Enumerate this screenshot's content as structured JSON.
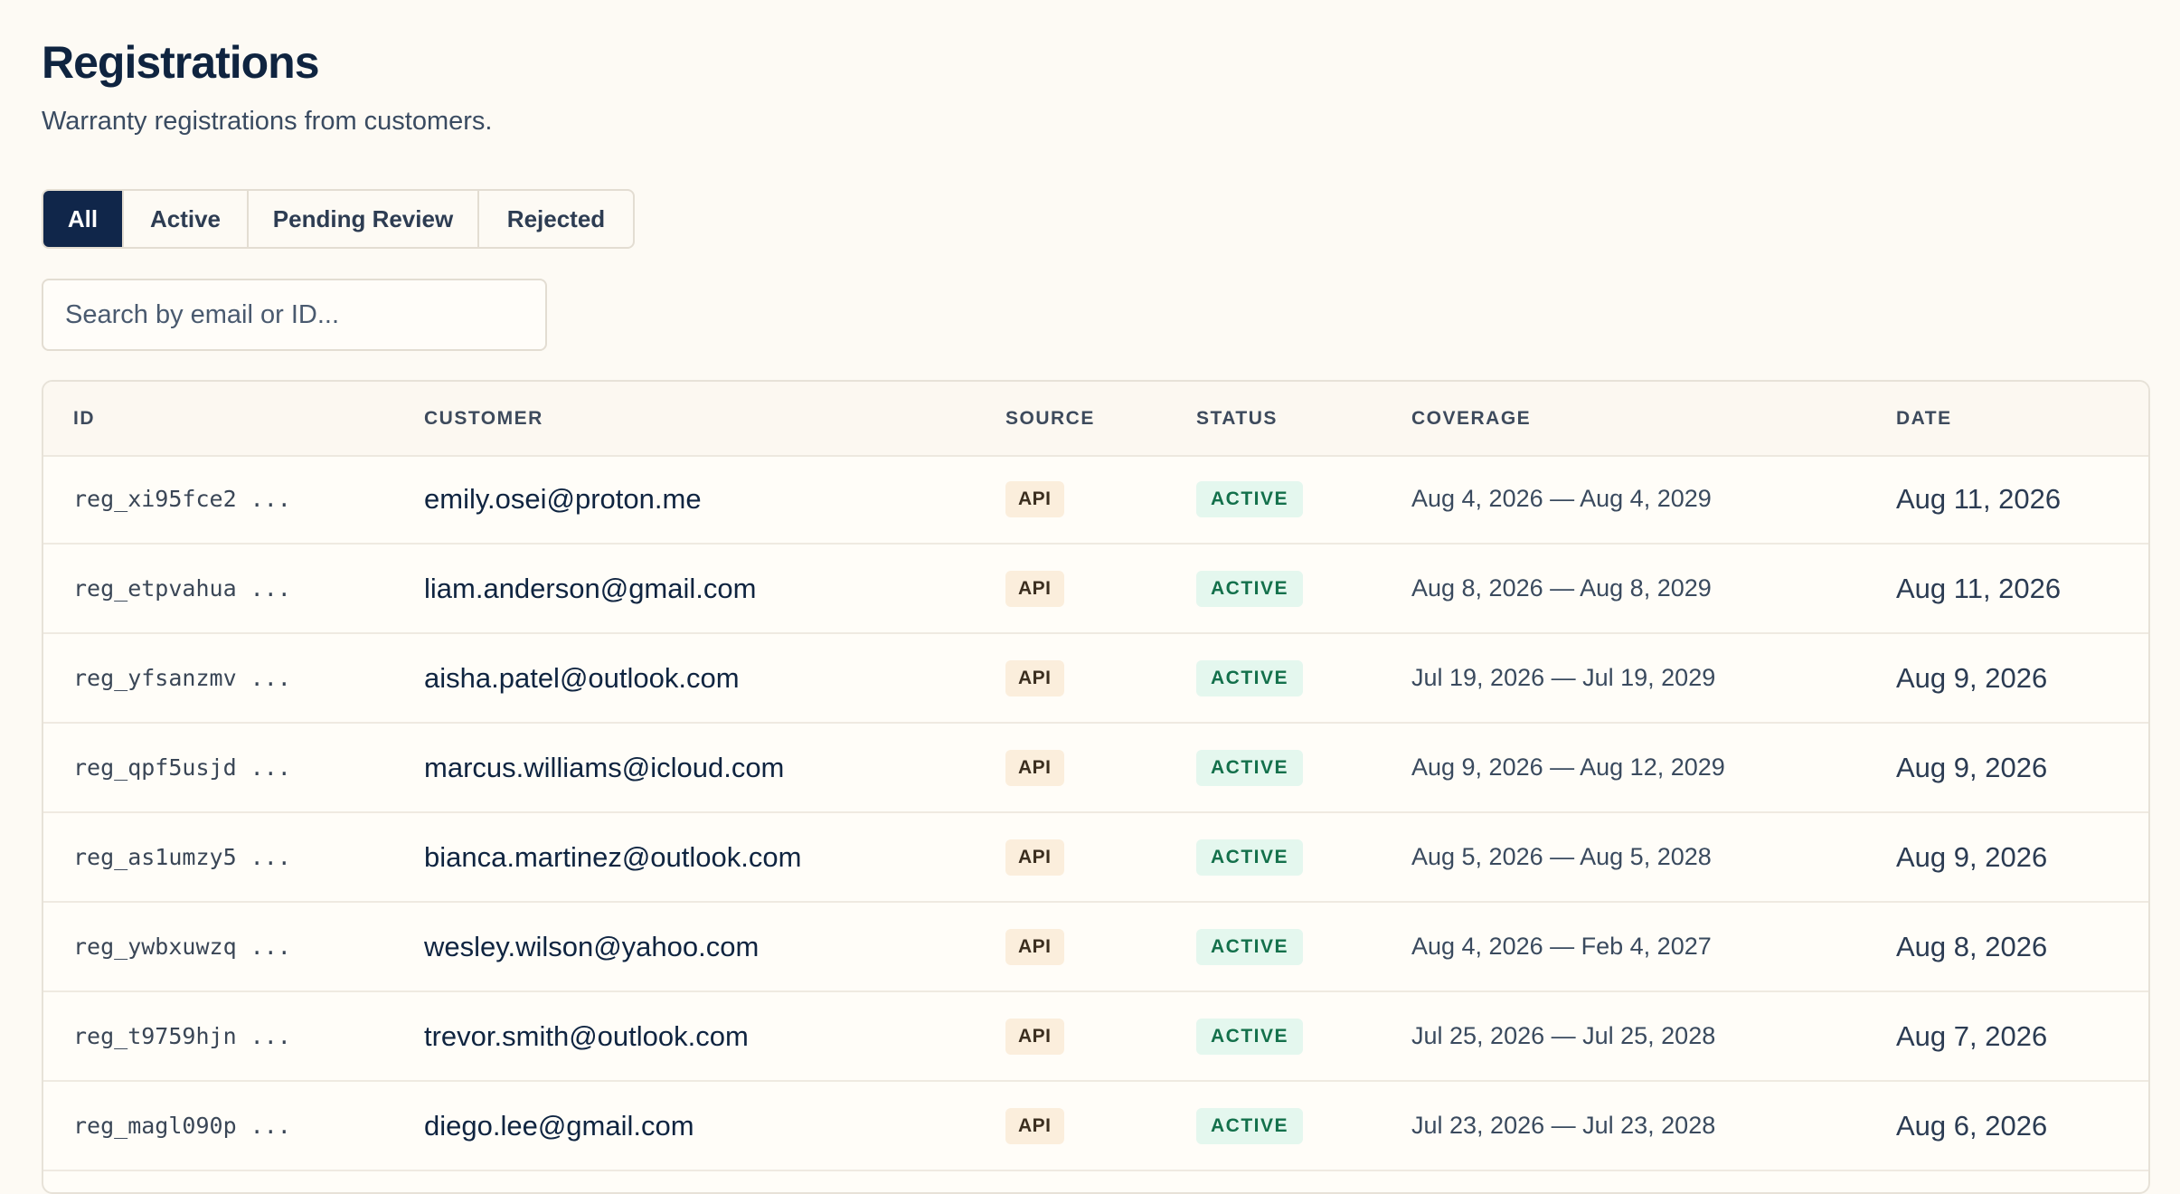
{
  "page": {
    "title": "Registrations",
    "subtitle": "Warranty registrations from customers."
  },
  "tabs": [
    {
      "label": "All",
      "selected": true
    },
    {
      "label": "Active",
      "selected": false
    },
    {
      "label": "Pending Review",
      "selected": false
    },
    {
      "label": "Rejected",
      "selected": false
    }
  ],
  "search": {
    "placeholder": "Search by email or ID...",
    "value": ""
  },
  "table": {
    "headers": {
      "id": "ID",
      "customer": "CUSTOMER",
      "source": "SOURCE",
      "status": "STATUS",
      "coverage": "COVERAGE",
      "date": "DATE"
    },
    "rows": [
      {
        "id": "reg_xi95fce2 ...",
        "customer": "emily.osei@proton.me",
        "source": "API",
        "status": "ACTIVE",
        "coverage": "Aug 4, 2026 — Aug 4, 2029",
        "date": "Aug 11, 2026"
      },
      {
        "id": "reg_etpvahua ...",
        "customer": "liam.anderson@gmail.com",
        "source": "API",
        "status": "ACTIVE",
        "coverage": "Aug 8, 2026 — Aug 8, 2029",
        "date": "Aug 11, 2026"
      },
      {
        "id": "reg_yfsanzmv ...",
        "customer": "aisha.patel@outlook.com",
        "source": "API",
        "status": "ACTIVE",
        "coverage": "Jul 19, 2026 — Jul 19, 2029",
        "date": "Aug 9, 2026"
      },
      {
        "id": "reg_qpf5usjd ...",
        "customer": "marcus.williams@icloud.com",
        "source": "API",
        "status": "ACTIVE",
        "coverage": "Aug 9, 2026 — Aug 12, 2029",
        "date": "Aug 9, 2026"
      },
      {
        "id": "reg_as1umzy5 ...",
        "customer": "bianca.martinez@outlook.com",
        "source": "API",
        "status": "ACTIVE",
        "coverage": "Aug 5, 2026 — Aug 5, 2028",
        "date": "Aug 9, 2026"
      },
      {
        "id": "reg_ywbxuwzq ...",
        "customer": "wesley.wilson@yahoo.com",
        "source": "API",
        "status": "ACTIVE",
        "coverage": "Aug 4, 2026 — Feb 4, 2027",
        "date": "Aug 8, 2026"
      },
      {
        "id": "reg_t9759hjn ...",
        "customer": "trevor.smith@outlook.com",
        "source": "API",
        "status": "ACTIVE",
        "coverage": "Jul 25, 2026 — Jul 25, 2028",
        "date": "Aug 7, 2026"
      },
      {
        "id": "reg_magl090p ...",
        "customer": "diego.lee@gmail.com",
        "source": "API",
        "status": "ACTIVE",
        "coverage": "Jul 23, 2026 — Jul 23, 2028",
        "date": "Aug 6, 2026"
      }
    ]
  },
  "colors": {
    "background": "#fdfaf4",
    "accent": "#10264a",
    "status_active_bg": "#e4f7ee",
    "status_active_text": "#13704b",
    "source_bg": "#fbeedc"
  }
}
